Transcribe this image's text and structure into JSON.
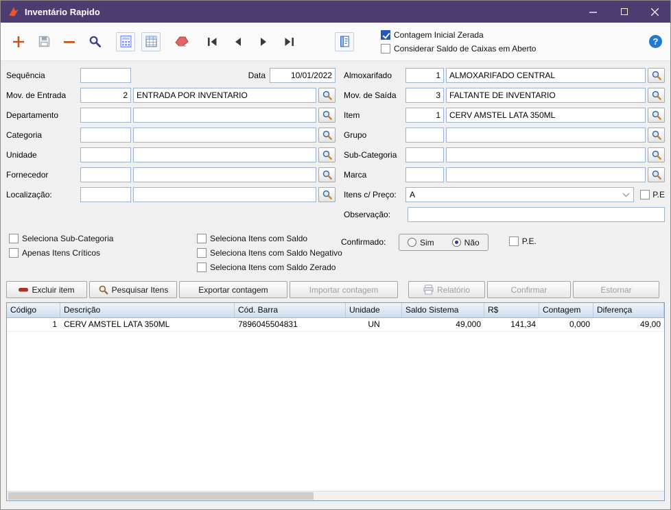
{
  "window": {
    "title": "Inventário Rapido"
  },
  "toolbar": {
    "checks": [
      {
        "label": "Contagem Inicial Zerada",
        "checked": true
      },
      {
        "label": "Considerar Saldo de Caixas em Aberto",
        "checked": false
      }
    ],
    "help_glyph": "?"
  },
  "form": {
    "sequencia": {
      "label": "Sequência",
      "value": ""
    },
    "data": {
      "label": "Data",
      "value": "10/01/2022"
    },
    "mov_entrada": {
      "label": "Mov. de Entrada",
      "code": "2",
      "desc": "ENTRADA POR INVENTARIO"
    },
    "departamento": {
      "label": "Departamento",
      "code": "",
      "desc": ""
    },
    "categoria": {
      "label": "Categoria",
      "code": "",
      "desc": ""
    },
    "unidade": {
      "label": "Unidade",
      "code": "",
      "desc": ""
    },
    "fornecedor": {
      "label": "Fornecedor",
      "code": "",
      "desc": ""
    },
    "localizacao": {
      "label": "Localização:",
      "code": "",
      "desc": ""
    },
    "almoxarifado": {
      "label": "Almoxarifado",
      "code": "1",
      "desc": "ALMOXARIFADO CENTRAL"
    },
    "mov_saida": {
      "label": "Mov. de Saída",
      "code": "3",
      "desc": "FALTANTE DE INVENTARIO"
    },
    "item": {
      "label": "Item",
      "code": "1",
      "desc": "CERV AMSTEL LATA 350ML"
    },
    "grupo": {
      "label": "Grupo",
      "code": "",
      "desc": ""
    },
    "sub_categoria": {
      "label": "Sub-Categoria",
      "code": "",
      "desc": ""
    },
    "marca": {
      "label": "Marca",
      "code": "",
      "desc": ""
    },
    "itens_preco": {
      "label": "Itens c/ Preço:",
      "value": "A",
      "pe_label": "P.E",
      "pe_checked": false
    },
    "observacao": {
      "label": "Observação:",
      "value": ""
    }
  },
  "filters": {
    "checks_left": [
      {
        "label": "Seleciona Sub-Categoria",
        "checked": false
      },
      {
        "label": "Apenas Itens Críticos",
        "checked": false
      }
    ],
    "checks_mid": [
      {
        "label": "Seleciona Itens com Saldo",
        "checked": false
      },
      {
        "label": "Seleciona Itens com Saldo Negativo",
        "checked": false
      },
      {
        "label": "Seleciona Itens com Saldo Zerado",
        "checked": false
      }
    ],
    "confirmado": {
      "label": "Confirmado:",
      "options": [
        {
          "label": "Sim",
          "selected": false
        },
        {
          "label": "Não",
          "selected": true
        }
      ]
    },
    "pe": {
      "label": "P.E.",
      "checked": false
    }
  },
  "actions": [
    {
      "label": "Excluir item",
      "enabled": true
    },
    {
      "label": "Pesquisar Itens",
      "enabled": true
    },
    {
      "label": "Exportar contagem",
      "enabled": true
    },
    {
      "label": "Importar contagem",
      "enabled": false
    },
    {
      "label": "Relatório",
      "enabled": false
    },
    {
      "label": "Confirmar",
      "enabled": false
    },
    {
      "label": "Estornar",
      "enabled": false
    }
  ],
  "table": {
    "headers": [
      "Código",
      "Descrição",
      "Cód. Barra",
      "Unidade",
      "Saldo Sistema",
      "R$",
      "Contagem",
      "Diferença"
    ],
    "rows": [
      [
        "1",
        "CERV AMSTEL LATA 350ML",
        "7896045504831",
        "UN",
        "49,000",
        "141,34",
        "0,000",
        "49,00"
      ]
    ]
  },
  "colors": {
    "titlebar": "#4d3c6f",
    "checkbox_accent": "#2456bd",
    "table_header_top": "#eef4fc",
    "table_header_bottom": "#cddded"
  }
}
